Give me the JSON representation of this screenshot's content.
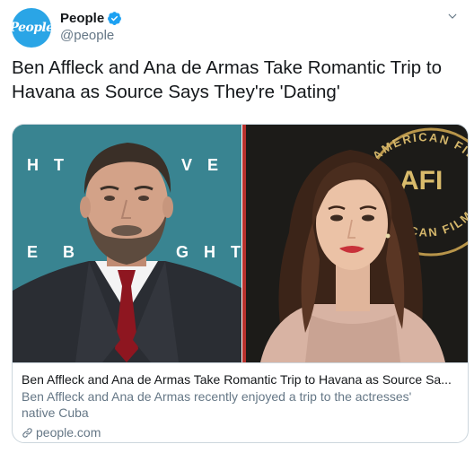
{
  "account": {
    "avatar_text": "People",
    "display_name": "People",
    "handle": "@people"
  },
  "tweet": {
    "text": "Ben Affleck and Ana de Armas Take Romantic Trip to Havana as Source Says They're 'Dating'"
  },
  "card": {
    "title": "Ben Affleck and Ana de Armas Take Romantic Trip to Havana as Source Sa...",
    "description": "Ben Affleck and Ana de Armas recently enjoyed a trip to the actresses' native Cuba",
    "domain": "people.com",
    "backdrop_left": {
      "row1_a": "H T",
      "row1_b": "V E",
      "row2_a": "E",
      "row2_b": "B",
      "row2_c": "G H T"
    },
    "backdrop_right": {
      "arc_top": "AMERICAN FILM",
      "logo": "AFI",
      "arc_bottom": "ICAN FILM"
    }
  },
  "colors": {
    "avatar_bg": "#2aa5e6",
    "verified": "#1da1f2",
    "left_backdrop": "#3c8a97",
    "right_backdrop": "#1a1a18",
    "gold": "#c9a24a"
  },
  "icons": [
    "verified-badge-icon",
    "chevron-down-icon",
    "link-icon"
  ]
}
